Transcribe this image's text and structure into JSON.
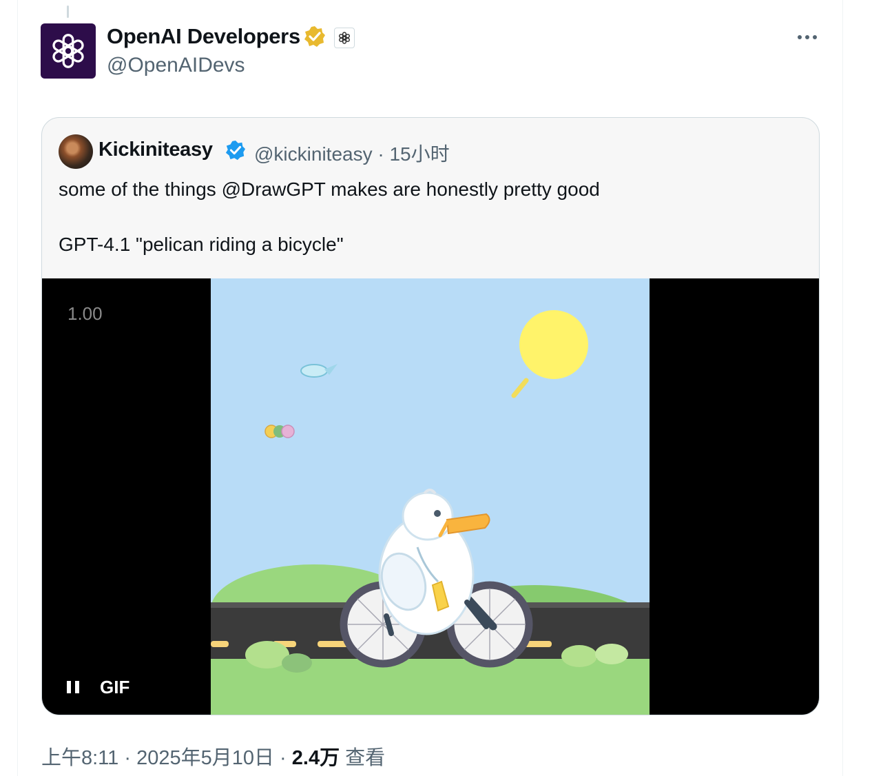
{
  "author": {
    "name": "OpenAI Developers",
    "handle": "@OpenAIDevs",
    "avatar_icon": "openai-logo-icon",
    "verified_badge": "gold-verified-icon",
    "affiliation_badge": "openai-affiliate-icon"
  },
  "actions": {
    "more_icon": "more-horizontal-icon"
  },
  "quoted_tweet": {
    "author_name": "Kickiniteasy",
    "handle": "@kickiniteasy",
    "separator": " · ",
    "time": "15小时",
    "text_line1": "some of the things @DrawGPT makes are honestly pretty good",
    "text_line2": "GPT-4.1 \"pelican riding a bicycle\"",
    "media": {
      "playback_rate": "1.00",
      "badge": "GIF",
      "pause_icon": "pause-icon"
    }
  },
  "footer": {
    "time": "上午8:11",
    "sep1": " · ",
    "date": "2025年5月10日",
    "sep2": " · ",
    "views_count": "2.4万",
    "views_label": "查看"
  },
  "colors": {
    "gold_badge": "#e8b92f",
    "blue_badge": "#1d9bf0",
    "avatar_bg": "#2d0d4a",
    "sky": "#b8dcf7",
    "grass": "#8fd07a",
    "road": "#3b3b3b"
  }
}
